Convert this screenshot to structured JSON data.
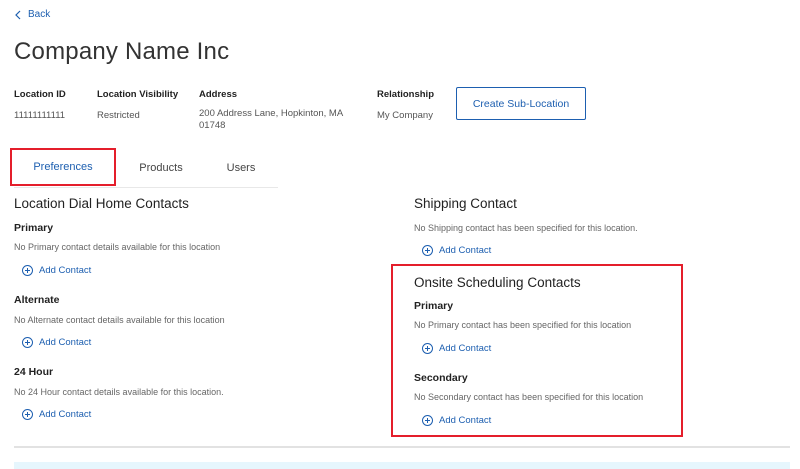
{
  "nav": {
    "back_label": "Back"
  },
  "page": {
    "title": "Company Name Inc"
  },
  "meta": {
    "location_id": {
      "label": "Location ID",
      "value": "11111111111"
    },
    "visibility": {
      "label": "Location Visibility",
      "value": "Restricted"
    },
    "address": {
      "label": "Address",
      "line1": "200 Address Lane, Hopkinton, MA",
      "line2": "01748"
    },
    "relationship": {
      "label": "Relationship",
      "value": "My Company"
    },
    "create_button": "Create Sub-Location"
  },
  "tabs": [
    {
      "label": "Preferences",
      "active": true
    },
    {
      "label": "Products",
      "active": false
    },
    {
      "label": "Users",
      "active": false
    }
  ],
  "dial_home": {
    "title": "Location Dial Home Contacts",
    "primary": {
      "label": "Primary",
      "note": "No Primary contact details available for this location",
      "add": "Add Contact"
    },
    "alternate": {
      "label": "Alternate",
      "note": "No Alternate contact details available for this location",
      "add": "Add Contact"
    },
    "hour24": {
      "label": "24 Hour",
      "note": "No 24 Hour contact details available for this location.",
      "add": "Add Contact"
    }
  },
  "shipping": {
    "title": "Shipping Contact",
    "note": "No Shipping contact has been specified for this location.",
    "add": "Add Contact"
  },
  "onsite": {
    "title": "Onsite Scheduling Contacts",
    "primary": {
      "label": "Primary",
      "note": "No Primary contact has been specified for this location",
      "add": "Add Contact"
    },
    "secondary": {
      "label": "Secondary",
      "note": "No Secondary contact has been specified for this location",
      "add": "Add Contact"
    }
  },
  "colors": {
    "accent": "#1d5fb0",
    "highlight": "#e41e2b",
    "banner": "#e6f6fd"
  }
}
